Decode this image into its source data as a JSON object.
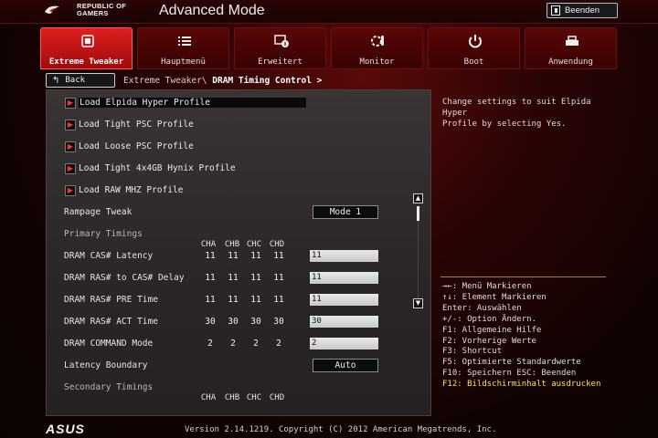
{
  "header": {
    "brand_line1": "REPUBLIC OF",
    "brand_line2": "GAMERS",
    "mode_title": "Advanced Mode",
    "exit_label": "Beenden"
  },
  "tabs": [
    {
      "label": "Extreme Tweaker",
      "icon": "tweaker-icon",
      "active": true
    },
    {
      "label": "Hauptmenü",
      "icon": "list-icon",
      "active": false
    },
    {
      "label": "Erweitert",
      "icon": "advanced-icon",
      "active": false
    },
    {
      "label": "Monitor",
      "icon": "monitor-icon",
      "active": false
    },
    {
      "label": "Boot",
      "icon": "power-icon",
      "active": false
    },
    {
      "label": "Anwendung",
      "icon": "tool-icon",
      "active": false
    }
  ],
  "breadcrumb": {
    "back_label": "Back",
    "path_prefix": "Extreme Tweaker\\",
    "current": "DRAM Timing Control >"
  },
  "profiles": [
    {
      "label": "Load Elpida Hyper Profile",
      "selected": true
    },
    {
      "label": "Load Tight PSC Profile",
      "selected": false
    },
    {
      "label": "Load Loose PSC Profile",
      "selected": false
    },
    {
      "label": "Load Tight 4x4GB Hynix Profile",
      "selected": false
    },
    {
      "label": "Load RAW MHZ Profile",
      "selected": false
    }
  ],
  "rampage_tweak": {
    "label": "Rampage Tweak",
    "value": "Mode 1"
  },
  "primary_timings": {
    "heading": "Primary Timings",
    "columns": [
      "CHA",
      "CHB",
      "CHC",
      "CHD"
    ],
    "rows": [
      {
        "label": "DRAM CAS# Latency",
        "values": [
          "11",
          "11",
          "11",
          "11"
        ],
        "input": "11"
      },
      {
        "label": "DRAM RAS# to CAS# Delay",
        "values": [
          "11",
          "11",
          "11",
          "11"
        ],
        "input": "11"
      },
      {
        "label": "DRAM RAS# PRE Time",
        "values": [
          "11",
          "11",
          "11",
          "11"
        ],
        "input": "11"
      },
      {
        "label": "DRAM RAS# ACT Time",
        "values": [
          "30",
          "30",
          "30",
          "30"
        ],
        "input": "30"
      },
      {
        "label": "DRAM COMMAND Mode",
        "values": [
          "2",
          "2",
          "2",
          "2"
        ],
        "input": "2"
      }
    ]
  },
  "latency_boundary": {
    "label": "Latency Boundary",
    "value": "Auto"
  },
  "secondary_timings": {
    "heading": "Secondary Timings",
    "columns": [
      "CHA",
      "CHB",
      "CHC",
      "CHD"
    ]
  },
  "help": {
    "text": "Change settings to suit Elpida Hyper\nProfile by selecting Yes."
  },
  "keys": [
    {
      "text": "→←: Menü Markieren",
      "highlight": false
    },
    {
      "text": "↑↓: Element Markieren",
      "highlight": false
    },
    {
      "text": "Enter: Auswählen",
      "highlight": false
    },
    {
      "text": "+/-: Option Ändern.",
      "highlight": false
    },
    {
      "text": "F1: Allgemeine Hilfe",
      "highlight": false
    },
    {
      "text": "F2: Vorherige Werte",
      "highlight": false
    },
    {
      "text": "F3: Shortcut",
      "highlight": false
    },
    {
      "text": "F5: Optimierte Standardwerte",
      "highlight": false
    },
    {
      "text": "F10: Speichern  ESC: Beenden",
      "highlight": false
    },
    {
      "text": "F12: Bildschirminhalt ausdrucken",
      "highlight": true
    }
  ],
  "footer": {
    "logo": "ASUS",
    "version": "Version 2.14.1219. Copyright (C) 2012 American Megatrends, Inc."
  },
  "colors": {
    "accent": "#e02020",
    "highlight_key": "#ffe44a",
    "panel": "#2e2a2a"
  }
}
